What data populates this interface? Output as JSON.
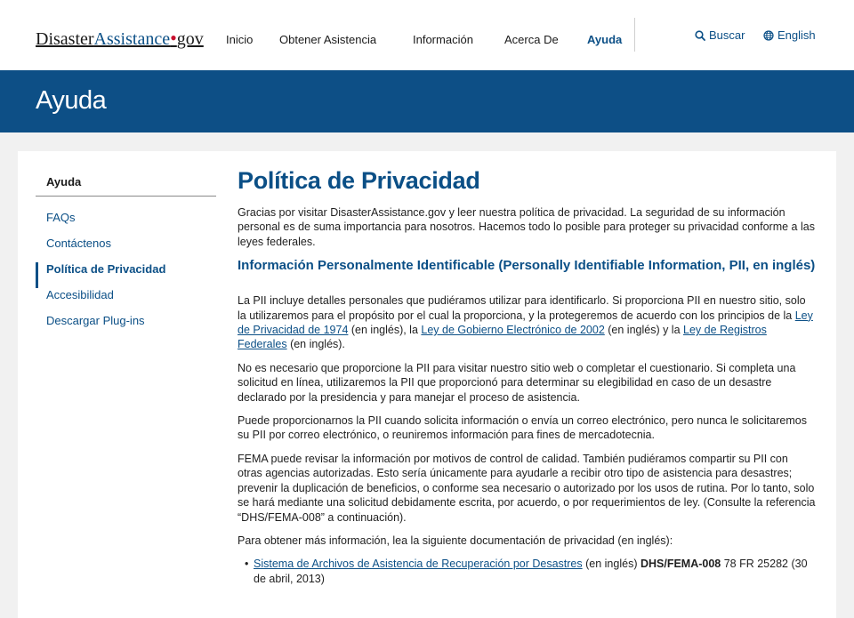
{
  "header": {
    "logo": {
      "part1": "Disaster",
      "part2": "Assistance",
      "dot": "•",
      "part3": "gov"
    },
    "nav": [
      {
        "label": "Inicio"
      },
      {
        "label": "Obtener Asistencia"
      },
      {
        "label": "Información"
      },
      {
        "label": "Acerca De"
      },
      {
        "label": "Ayuda"
      }
    ],
    "active_nav": "Ayuda",
    "search_label": "Buscar",
    "search_icon": "search-icon",
    "language_label": "English",
    "language_icon": "globe-icon"
  },
  "banner": {
    "title": "Ayuda"
  },
  "sidebar": {
    "title": "Ayuda",
    "items": [
      {
        "label": "FAQs"
      },
      {
        "label": "Contáctenos"
      },
      {
        "label": "Política de Privacidad"
      },
      {
        "label": "Accesibilidad"
      },
      {
        "label": "Descargar Plug-ins"
      }
    ],
    "active_item": "Política de Privacidad"
  },
  "main": {
    "title": "Política de Privacidad",
    "intro": "Gracias por visitar DisasterAssistance.gov y leer nuestra política de privacidad. La seguridad de su información personal es de suma importancia para nosotros. Hacemos todo lo posible para proteger su privacidad conforme a las leyes federales.",
    "section_title": "Información Personalmente Identificable (Personally Identifiable Information, PII, en inglés)",
    "p1": {
      "t1": "La PII incluye detalles personales que pudiéramos utilizar para identificarlo. Si proporciona PII en nuestro sitio, solo la utilizaremos para el propósito por el cual la proporciona, y la protegeremos de acuerdo con los principios de la ",
      "link1": "Ley de Privacidad de 1974",
      "t2": " (en inglés), la ",
      "link2": "Ley de Gobierno Electrónico de 2002",
      "t3": " (en inglés) y la ",
      "link3": "Ley de Registros Federales",
      "t4": " (en inglés)."
    },
    "p2": "No es necesario que proporcione la PII para visitar nuestro sitio web o completar el cuestionario. Si completa una solicitud en línea, utilizaremos la PII que proporcionó para determinar su elegibilidad en caso de un desastre declarado por la presidencia y para manejar el proceso de asistencia.",
    "p3": "Puede proporcionarnos la PII cuando solicita información o envía un correo electrónico, pero nunca le solicitaremos su PII por correo electrónico, o reuniremos información para fines de mercadotecnia.",
    "p4": "FEMA puede revisar la información por motivos de control de calidad. También pudiéramos compartir su PII con otras agencias autorizadas. Esto sería únicamente para ayudarle a recibir otro tipo de asistencia para desastres; prevenir la duplicación de beneficios, o conforme sea necesario o autorizado por los usos de rutina. Por lo tanto, solo se hará mediante una solicitud debidamente escrita, por acuerdo, o por requerimientos de ley. (Consulte la referencia “DHS/FEMA-008” a continuación).",
    "p5": "Para obtener más información, lea la siguiente documentación de privacidad (en inglés):",
    "list": [
      {
        "bullet": "•",
        "link": "Sistema de Archivos de Asistencia de Recuperación por Desastres",
        "t1": " (en inglés) ",
        "bold": "DHS/FEMA-008",
        "t2": " 78 FR 25282 (30 de abril, 2013)"
      }
    ]
  },
  "colors": {
    "brand_blue": "#0d4f86",
    "link_blue": "#0b4f86",
    "logo_dot_red": "#c8102e",
    "page_bg": "#f1f1f1"
  }
}
